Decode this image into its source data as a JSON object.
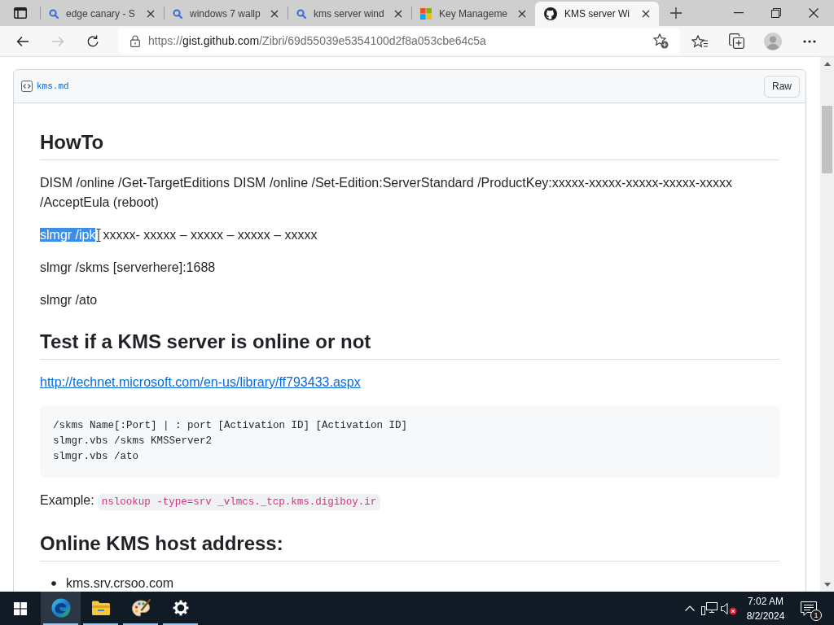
{
  "tabs": [
    {
      "kind": "search",
      "title": "edge canary - S",
      "selected": false
    },
    {
      "kind": "search",
      "title": "windows 7 wallp",
      "selected": false
    },
    {
      "kind": "search",
      "title": "kms server wind",
      "selected": false
    },
    {
      "kind": "microsoft",
      "title": "Key Manageme",
      "selected": false
    },
    {
      "kind": "github",
      "title": "KMS server Wi",
      "selected": true
    }
  ],
  "toolbar": {
    "nav_buttons": [
      {
        "kind": "back",
        "disabled": false
      },
      {
        "kind": "forward",
        "disabled": true
      },
      {
        "kind": "reload",
        "disabled": false
      }
    ],
    "address": {
      "scheme": "https://",
      "host": "gist.github.com",
      "path": "/Zibri/69d55039e5354100d2f8a053cbe64c5a"
    }
  },
  "gist": {
    "filename": "kms.md",
    "raw_button": "Raw",
    "blocks": [
      {
        "kind": "heading",
        "text": "HowTo"
      },
      {
        "kind": "paragraph",
        "text": "DISM /online /Get-TargetEditions DISM /online /Set-Edition:ServerStandard /ProductKey:xxxxx-xxxxx-xxxxx-xxxxx-xxxxx /AcceptEula (reboot)"
      },
      {
        "kind": "segments",
        "segments": [
          {
            "text": "slmgr /ipk",
            "selected": true
          },
          {
            "text": "xxxxx- xxxxx – xxxxx – xxxxx – xxxxx",
            "selected": false
          }
        ]
      },
      {
        "kind": "paragraph",
        "text": "slmgr /skms [serverhere]:1688"
      },
      {
        "kind": "paragraph",
        "text": "slmgr /ato"
      },
      {
        "kind": "heading",
        "text": "Test if a KMS server is online or not"
      },
      {
        "kind": "link",
        "text": "http://technet.microsoft.com/en-us/library/ff793433.aspx"
      },
      {
        "kind": "code_block",
        "lines": [
          "/skms Name[:Port] | : port [Activation ID] [Activation ID]",
          "slmgr.vbs /skms KMSServer2",
          "slmgr.vbs /ato"
        ]
      },
      {
        "kind": "example",
        "label": "Example:",
        "code": "nslookup -type=srv _vlmcs._tcp.kms.digiboy.ir"
      },
      {
        "kind": "heading",
        "text": "Online KMS host address:"
      },
      {
        "kind": "bullet_list",
        "items": [
          "kms.srv.crsoo.com"
        ]
      }
    ]
  },
  "taskbar": {
    "apps": [
      {
        "kind": "browser",
        "selected": true,
        "running": true
      },
      {
        "kind": "folder",
        "selected": false,
        "running": true
      },
      {
        "kind": "paint",
        "selected": false,
        "running": true
      },
      {
        "kind": "settings",
        "selected": false,
        "running": true
      }
    ],
    "tray": {
      "volume_muted": true
    },
    "clock": {
      "time": "7:02 AM",
      "date": "8/2/2024"
    },
    "notification_count": "1"
  }
}
